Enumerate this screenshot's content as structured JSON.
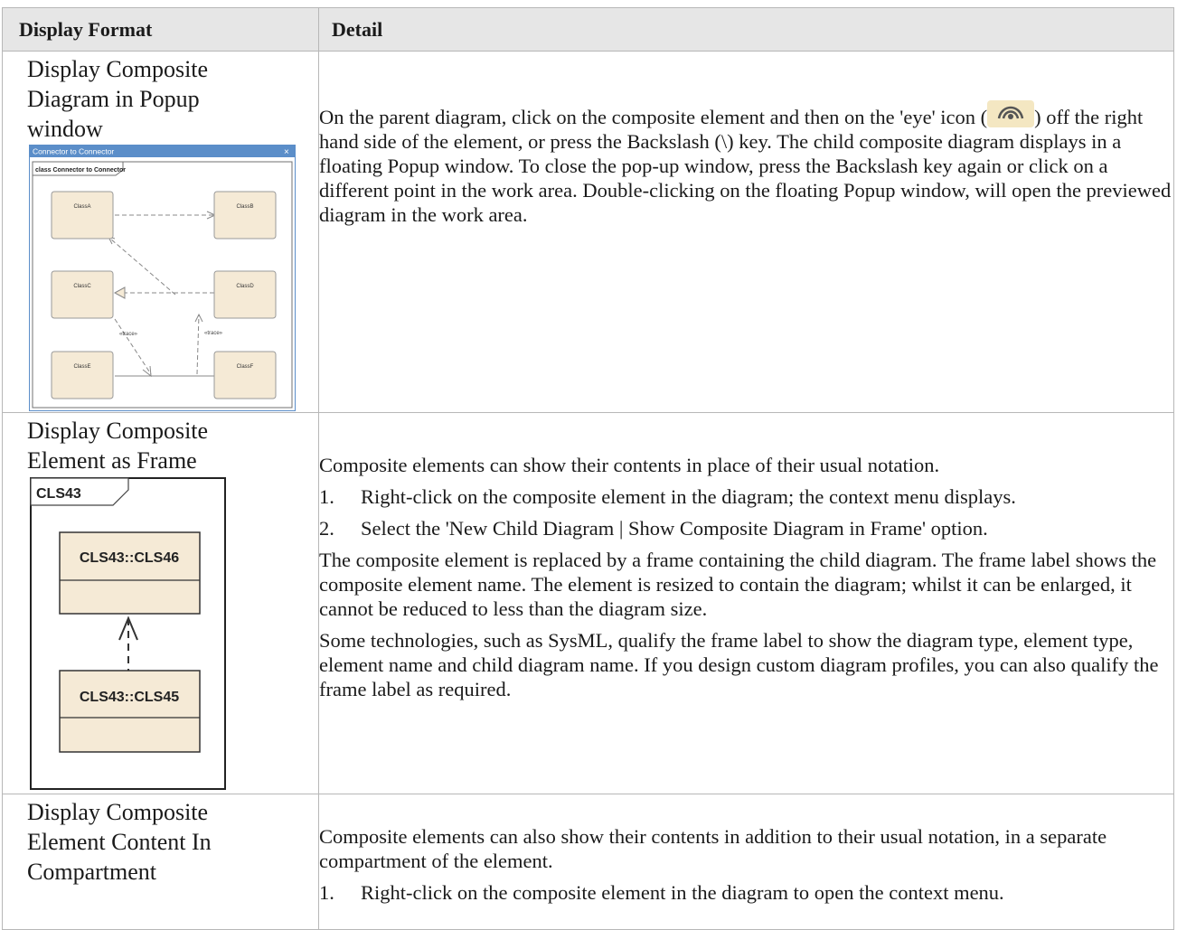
{
  "header": {
    "col1": "Display Format",
    "col2": "Detail"
  },
  "rows": [
    {
      "format": "Display Composite Diagram in Popup window",
      "detail_pre": "On the parent diagram, click on the composite element and then on the 'eye' icon (",
      "detail_post": ") off the right hand side of the element, or press the Backslash (\\) key.  The child composite diagram displays in a floating Popup window. To close the pop-up window, press the Backslash key again or click on a different point in the work area.  Double-clicking on the floating Popup window, will open the previewed diagram in the work area.",
      "eye_icon": "eye-icon",
      "popup": {
        "title": "Connector to Connector",
        "close": "×",
        "frame_label": "class Connector to Connector",
        "classes": [
          "ClassA",
          "ClassB",
          "ClassC",
          "ClassD",
          "ClassE",
          "ClassF"
        ],
        "stereotype_left": "«trace»",
        "stereotype_right": "«trace»"
      }
    },
    {
      "format": "Display Composite Element as Frame",
      "intro": "Composite elements can show their contents in place of their usual notation.",
      "steps": [
        {
          "num": "1.",
          "text": "Right-click on the composite element in the diagram; the context menu displays."
        },
        {
          "num": "2.",
          "text": "Select the 'New Child Diagram | Show Composite Diagram in Frame' option."
        }
      ],
      "para1": "The composite element is replaced by a frame containing the child diagram. The frame label shows the composite element name. The element is resized to contain the diagram; whilst it can be enlarged, it cannot be reduced to less than the diagram size.",
      "para2": "Some technologies, such as SysML, qualify the frame label to show the diagram type, element type, element name and child diagram name. If you design custom diagram profiles, you can also qualify the frame label as required.",
      "frame": {
        "label": "CLS43",
        "class1": "CLS43::CLS46",
        "class2": "CLS43::CLS45"
      }
    },
    {
      "format": "Display Composite Element Content In Compartment",
      "intro": "Composite elements can also show their contents in addition to their usual notation, in a separate compartment of the element.",
      "steps": [
        {
          "num": "1.",
          "text": "Right-click on the composite element in the diagram to open the context menu."
        }
      ]
    }
  ],
  "colors": {
    "header_bg": "#e6e6e6",
    "border": "#b7b7b7",
    "class_fill": "#f5ead6",
    "popup_title": "#5b8ec9"
  }
}
